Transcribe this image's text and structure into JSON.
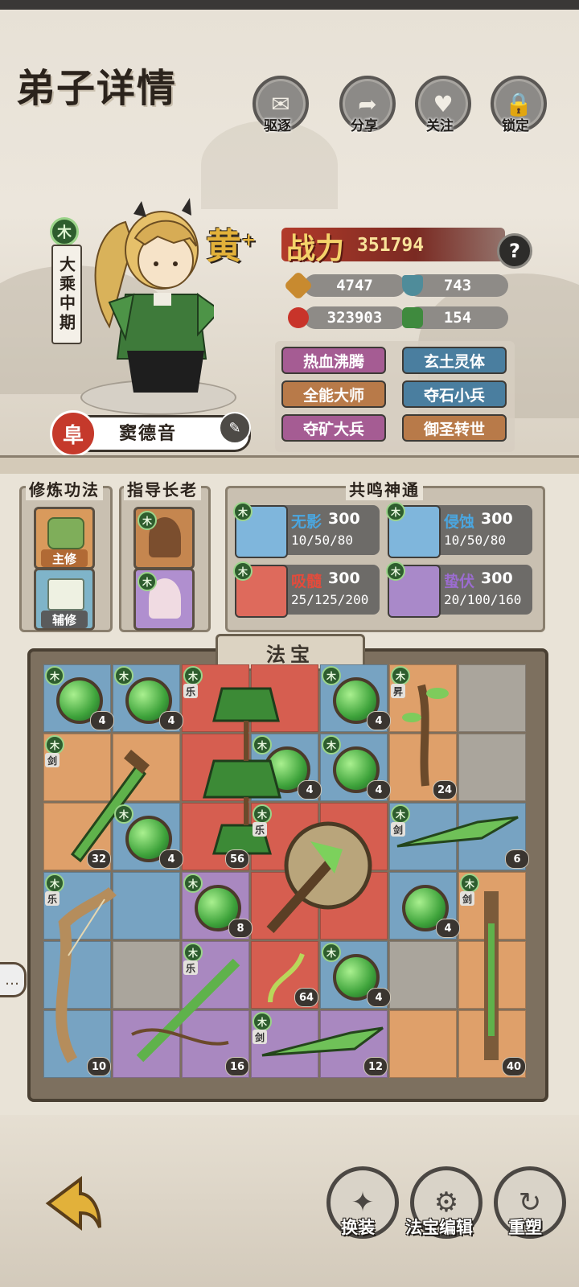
{
  "header": {
    "title": "弟子详情",
    "actions": [
      {
        "label": "驱逐",
        "icon": "scroll-icon"
      },
      {
        "label": "分享",
        "icon": "share-icon"
      },
      {
        "label": "关注",
        "icon": "heart-icon"
      },
      {
        "label": "锁定",
        "icon": "lock-icon"
      }
    ]
  },
  "disciple": {
    "element": "木",
    "realm": "大乘中期",
    "grade": "黄",
    "grade_plus": "+",
    "status_tag": "阜",
    "name": "窦德音",
    "power_label": "战力",
    "power_value": "351794",
    "help": "?",
    "stats": {
      "attack": "4747",
      "defense": "743",
      "hp": "323903",
      "speed": "154"
    },
    "traits": [
      {
        "label": "热血沸腾",
        "color": "pink"
      },
      {
        "label": "玄土灵体",
        "color": "blue"
      },
      {
        "label": "全能大师",
        "color": "orange"
      },
      {
        "label": "夺石小兵",
        "color": "blue"
      },
      {
        "label": "夺矿大兵",
        "color": "pink"
      },
      {
        "label": "御圣转世",
        "color": "orange"
      }
    ]
  },
  "cultivation": {
    "title": "修炼功法",
    "main_tag": "主修",
    "aux_tag": "辅修"
  },
  "elders": {
    "title": "指导长老",
    "badge": "木"
  },
  "resonance": {
    "title": "共鸣神通",
    "skills": [
      {
        "name": "无影",
        "power": "300",
        "progress": "10/50/80",
        "name_color": "#4aa6e0",
        "icon_bg": "#7fb6dc"
      },
      {
        "name": "侵蚀",
        "power": "300",
        "progress": "10/50/80",
        "name_color": "#4aa6e0",
        "icon_bg": "#7fb6dc"
      },
      {
        "name": "吸髓",
        "power": "300",
        "progress": "25/125/200",
        "name_color": "#e34b3c",
        "icon_bg": "#de6a5c"
      },
      {
        "name": "蛰伏",
        "power": "300",
        "progress": "20/100/160",
        "name_color": "#9b6cd0",
        "icon_bg": "#a989c9"
      }
    ]
  },
  "treasure": {
    "title": "法宝",
    "badge": "木",
    "tags": {
      "music": "乐",
      "sword": "剑",
      "ascend": "昇"
    },
    "counts": [
      "4",
      "4",
      "4",
      "24",
      "4",
      "4",
      "32",
      "4",
      "56",
      "6",
      "8",
      "4",
      "64",
      "4",
      "10",
      "16",
      "12",
      "40"
    ]
  },
  "footer": {
    "buttons": [
      {
        "label": "换装",
        "icon": "outfit-icon"
      },
      {
        "label": "法宝编辑",
        "icon": "treasure-edit-icon"
      },
      {
        "label": "重塑",
        "icon": "reshape-icon"
      }
    ]
  }
}
